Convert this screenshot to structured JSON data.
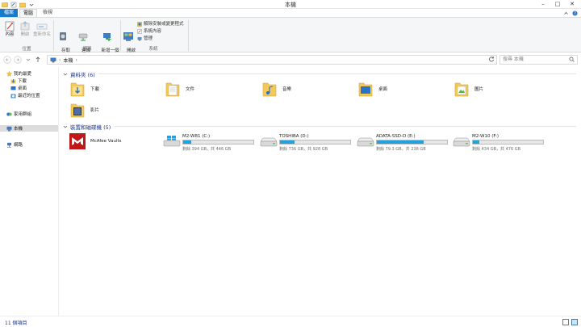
{
  "window": {
    "title": "本機"
  },
  "ribbon_tabs": [
    "檔案",
    "電腦",
    "檢視"
  ],
  "ribbon": {
    "location_group": {
      "label": "位置",
      "buttons": [
        "內容",
        "開啟",
        "重新命名"
      ]
    },
    "network_group": {
      "label": "網路",
      "buttons": [
        "存取\n媒體 ▾",
        "連線\n網路磁碟機 ▾",
        "新增一個\n網路位置"
      ]
    },
    "system_group": {
      "label": "系統",
      "open_control_panel": "開啟\n控制台",
      "small_buttons": [
        "解除安裝或變更程式",
        "系統內容",
        "管理"
      ]
    }
  },
  "address": {
    "path": "本機",
    "search_placeholder": "搜尋 本機"
  },
  "nav": {
    "favorites": "我的最愛",
    "fav_items": [
      "下載",
      "桌面",
      "最近的位置"
    ],
    "homegroup": "家用群組",
    "this_pc": "本機",
    "network": "網路"
  },
  "sections": {
    "folders_title": "資料夾 (6)",
    "devices_title": "裝置和磁碟機 (5)"
  },
  "folders": [
    {
      "name": "下載"
    },
    {
      "name": "文件"
    },
    {
      "name": "音樂"
    },
    {
      "name": "桌面"
    },
    {
      "name": "圖片"
    },
    {
      "name": "影片"
    }
  ],
  "devices": [
    {
      "name": "McAfee Vaults"
    }
  ],
  "drives": [
    {
      "name": "M2-W81 (C:)",
      "free": "剩餘 394 GB，共 446 GB",
      "used_fraction": 0.12
    },
    {
      "name": "TOSHIBA (D:)",
      "free": "剩餘 736 GB，共 928 GB",
      "used_fraction": 0.21
    },
    {
      "name": "ADATA-SSD-D (E:)",
      "free": "剩餘 79.3 GB，共 238 GB",
      "used_fraction": 0.67
    },
    {
      "name": "M2-W10 (F:)",
      "free": "剩餘 434 GB，共 476 GB",
      "used_fraction": 0.09
    }
  ],
  "status": {
    "item_count": "11 個項目"
  },
  "colors": {
    "accent": "#1979ca",
    "drive_bar": "#26a0da",
    "section_title": "#1e3287"
  }
}
